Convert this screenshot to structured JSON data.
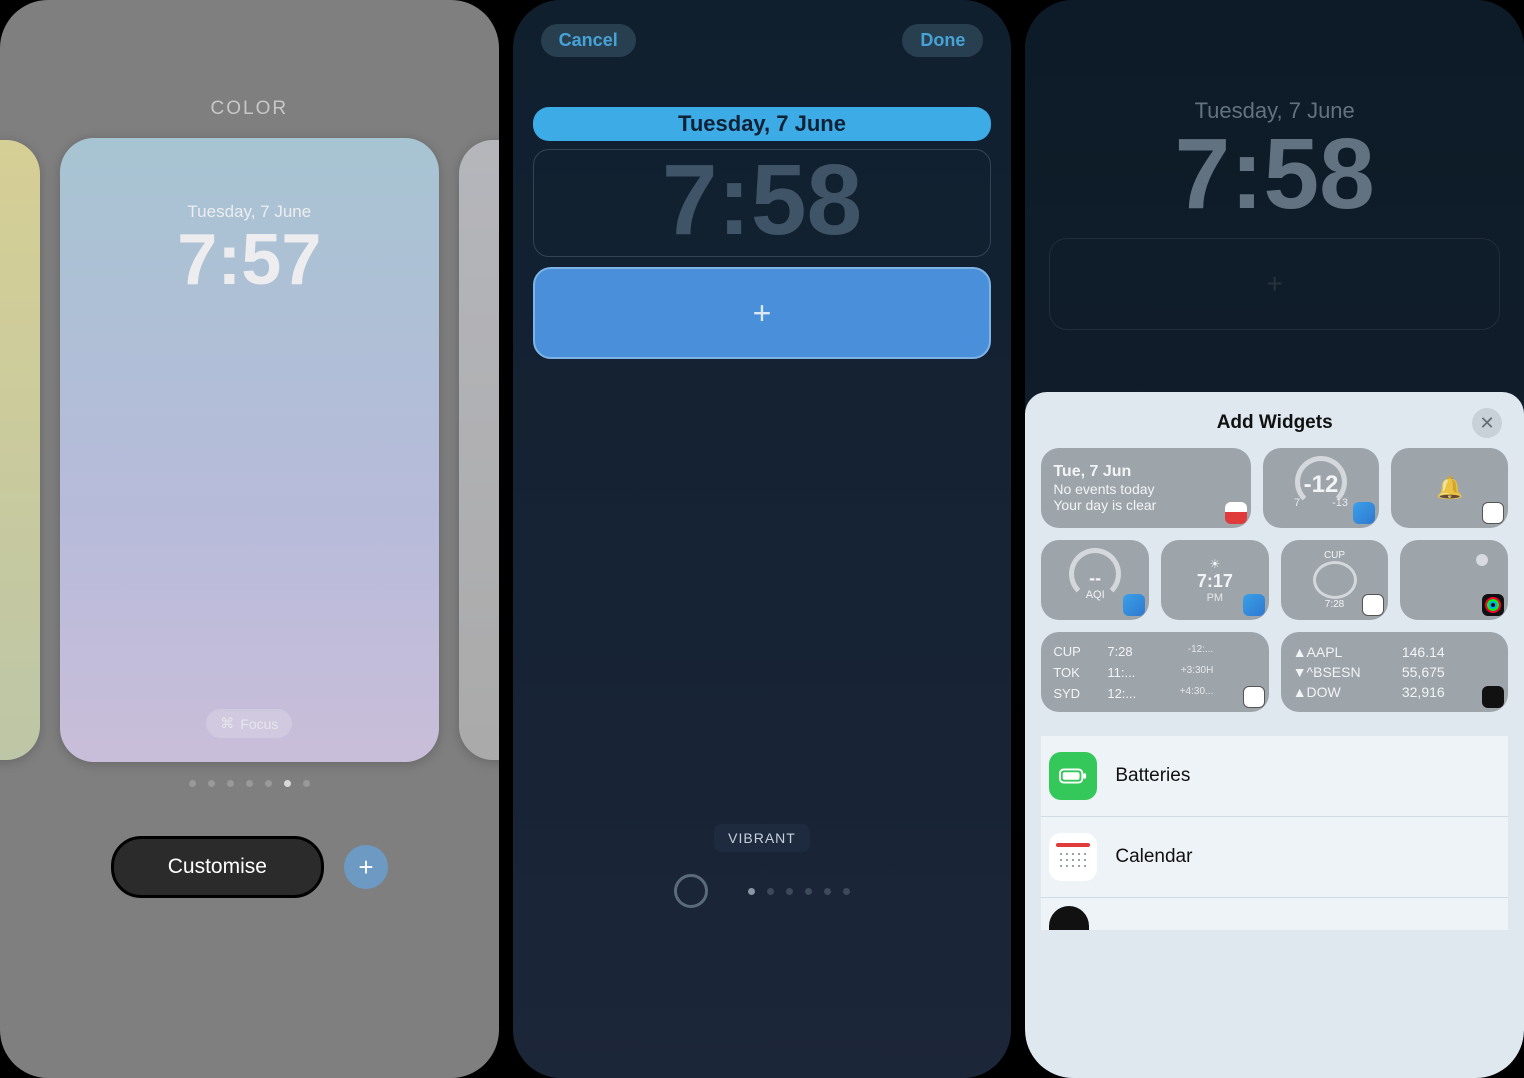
{
  "panel1": {
    "title": "COLOR",
    "date": "Tuesday, 7 June",
    "time": "7:57",
    "focus_label": "Focus",
    "customise_label": "Customise",
    "add_label": "+"
  },
  "panel2": {
    "cancel_label": "Cancel",
    "done_label": "Done",
    "date": "Tuesday, 7 June",
    "time": "7:58",
    "add_widget_glyph": "+",
    "style_label": "VIBRANT"
  },
  "panel3": {
    "date": "Tuesday, 7 June",
    "time": "7:58",
    "add_widget_glyph": "+",
    "sheet": {
      "title": "Add Widgets",
      "close_glyph": "✕",
      "widgets": {
        "calendar_wide": {
          "line1": "Tue, 7 Jun",
          "line2": "No events today",
          "line3": "Your day is clear"
        },
        "weather_sq": {
          "temp": "-12",
          "low": "7",
          "high": "-13"
        },
        "alarm_sq": {
          "icon": "bell"
        },
        "aqi_sq": {
          "value": "--",
          "label": "AQI"
        },
        "sunrise_sq": {
          "time": "7:17",
          "label": "PM"
        },
        "worldclock_analog_sq": {
          "city": "CUP",
          "time": "7:28"
        },
        "activity_sq": {
          "icon": "rings"
        },
        "worldclock_wide": {
          "rows": [
            {
              "city": "CUP",
              "time": "7:28",
              "diff": "-12:..."
            },
            {
              "city": "TOK",
              "time": "11:...",
              "diff": "+3:30H"
            },
            {
              "city": "SYD",
              "time": "12:...",
              "diff": "+4:30..."
            }
          ]
        },
        "stocks_wide": {
          "rows": [
            {
              "sym": "▲AAPL",
              "val": "146.14"
            },
            {
              "sym": "▼^BSESN",
              "val": "55,675"
            },
            {
              "sym": "▲DOW",
              "val": "32,916"
            }
          ]
        }
      },
      "apps": {
        "batteries": "Batteries",
        "calendar": "Calendar"
      }
    }
  }
}
